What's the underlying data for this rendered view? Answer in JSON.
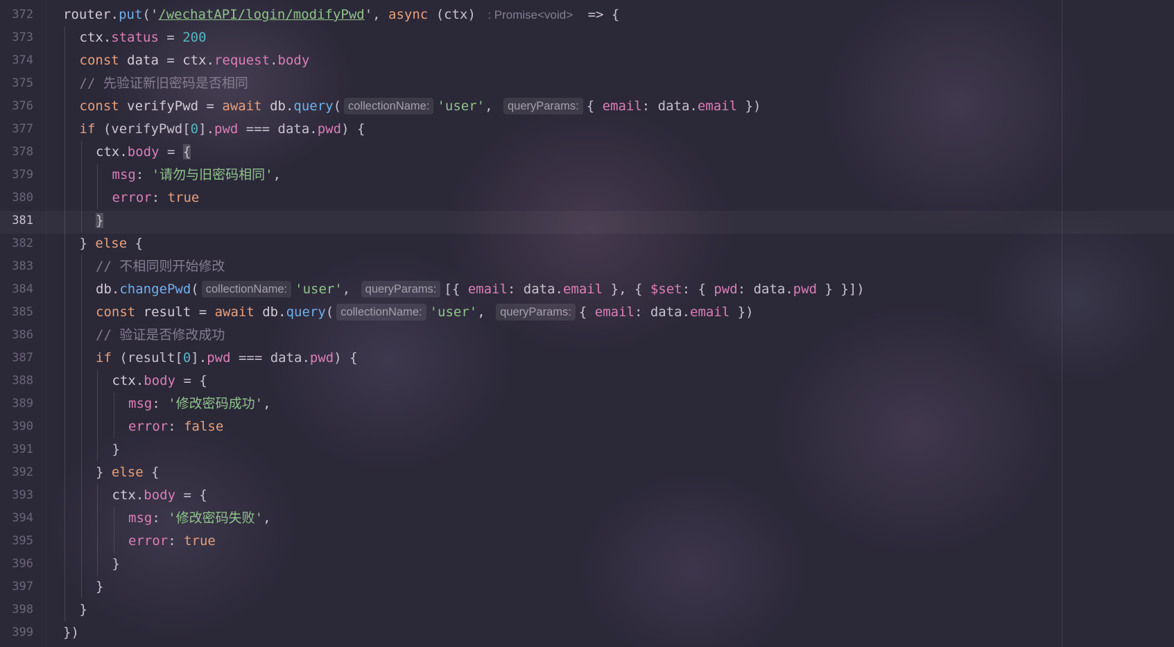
{
  "editor": {
    "current_line": "381",
    "lines": [
      {
        "n": "372",
        "indent": 0,
        "tokens": [
          {
            "t": "id",
            "v": "router."
          },
          {
            "t": "fn",
            "v": "put"
          },
          {
            "t": "pun",
            "v": "('"
          },
          {
            "t": "url",
            "v": "/wechatAPI/login/modifyPwd"
          },
          {
            "t": "pun",
            "v": "', "
          },
          {
            "t": "kw",
            "v": "async"
          },
          {
            "t": "pun",
            "v": " (ctx) "
          },
          {
            "t": "ret",
            "v": ": Promise<void>"
          },
          {
            "t": "pun",
            "v": " => {"
          }
        ]
      },
      {
        "n": "373",
        "indent": 1,
        "tokens": [
          {
            "t": "id",
            "v": "ctx."
          },
          {
            "t": "prop",
            "v": "status"
          },
          {
            "t": "pun",
            "v": " = "
          },
          {
            "t": "num",
            "v": "200"
          }
        ]
      },
      {
        "n": "374",
        "indent": 1,
        "tokens": [
          {
            "t": "kw",
            "v": "const"
          },
          {
            "t": "id",
            "v": " data = ctx."
          },
          {
            "t": "prop",
            "v": "request"
          },
          {
            "t": "pun",
            "v": "."
          },
          {
            "t": "prop",
            "v": "body"
          }
        ]
      },
      {
        "n": "375",
        "indent": 1,
        "tokens": [
          {
            "t": "cm",
            "v": "// 先验证新旧密码是否相同"
          }
        ]
      },
      {
        "n": "376",
        "indent": 1,
        "tokens": [
          {
            "t": "kw",
            "v": "const"
          },
          {
            "t": "id",
            "v": " verifyPwd = "
          },
          {
            "t": "kw",
            "v": "await"
          },
          {
            "t": "id",
            "v": " db."
          },
          {
            "t": "fn",
            "v": "query"
          },
          {
            "t": "pun",
            "v": "("
          },
          {
            "t": "hint",
            "v": "collectionName:"
          },
          {
            "t": "str",
            "v": "'user'"
          },
          {
            "t": "pun",
            "v": ", "
          },
          {
            "t": "hint",
            "v": "queryParams:"
          },
          {
            "t": "pun",
            "v": "{ "
          },
          {
            "t": "prop",
            "v": "email"
          },
          {
            "t": "pun",
            "v": ": data."
          },
          {
            "t": "prop",
            "v": "email"
          },
          {
            "t": "pun",
            "v": " })"
          }
        ]
      },
      {
        "n": "377",
        "indent": 1,
        "tokens": [
          {
            "t": "kw",
            "v": "if"
          },
          {
            "t": "pun",
            "v": " (verifyPwd["
          },
          {
            "t": "num",
            "v": "0"
          },
          {
            "t": "pun",
            "v": "]."
          },
          {
            "t": "prop",
            "v": "pwd"
          },
          {
            "t": "pun",
            "v": " === data."
          },
          {
            "t": "prop",
            "v": "pwd"
          },
          {
            "t": "pun",
            "v": ") {"
          }
        ]
      },
      {
        "n": "378",
        "indent": 2,
        "tokens": [
          {
            "t": "id",
            "v": "ctx."
          },
          {
            "t": "prop",
            "v": "body"
          },
          {
            "t": "pun",
            "v": " = "
          },
          {
            "t": "brace",
            "v": "{"
          }
        ]
      },
      {
        "n": "379",
        "indent": 3,
        "tokens": [
          {
            "t": "prop",
            "v": "msg"
          },
          {
            "t": "pun",
            "v": ": "
          },
          {
            "t": "str",
            "v": "'请勿与旧密码相同'"
          },
          {
            "t": "pun",
            "v": ","
          }
        ]
      },
      {
        "n": "380",
        "indent": 3,
        "tokens": [
          {
            "t": "prop",
            "v": "error"
          },
          {
            "t": "pun",
            "v": ": "
          },
          {
            "t": "kw",
            "v": "true"
          }
        ]
      },
      {
        "n": "381",
        "indent": 2,
        "tokens": [
          {
            "t": "brace",
            "v": "}"
          }
        ]
      },
      {
        "n": "382",
        "indent": 1,
        "tokens": [
          {
            "t": "pun",
            "v": "} "
          },
          {
            "t": "kw",
            "v": "else"
          },
          {
            "t": "pun",
            "v": " {"
          }
        ]
      },
      {
        "n": "383",
        "indent": 2,
        "tokens": [
          {
            "t": "cm",
            "v": "// 不相同则开始修改"
          }
        ]
      },
      {
        "n": "384",
        "indent": 2,
        "tokens": [
          {
            "t": "id",
            "v": "db."
          },
          {
            "t": "fn",
            "v": "changePwd"
          },
          {
            "t": "pun",
            "v": "("
          },
          {
            "t": "hint",
            "v": "collectionName:"
          },
          {
            "t": "str",
            "v": "'user'"
          },
          {
            "t": "pun",
            "v": ", "
          },
          {
            "t": "hint",
            "v": "queryParams:"
          },
          {
            "t": "pun",
            "v": "[{ "
          },
          {
            "t": "prop",
            "v": "email"
          },
          {
            "t": "pun",
            "v": ": data."
          },
          {
            "t": "prop",
            "v": "email"
          },
          {
            "t": "pun",
            "v": " }, { "
          },
          {
            "t": "prop",
            "v": "$set"
          },
          {
            "t": "pun",
            "v": ": { "
          },
          {
            "t": "prop",
            "v": "pwd"
          },
          {
            "t": "pun",
            "v": ": data."
          },
          {
            "t": "prop",
            "v": "pwd"
          },
          {
            "t": "pun",
            "v": " } }])"
          }
        ]
      },
      {
        "n": "385",
        "indent": 2,
        "tokens": [
          {
            "t": "kw",
            "v": "const"
          },
          {
            "t": "id",
            "v": " result = "
          },
          {
            "t": "kw",
            "v": "await"
          },
          {
            "t": "id",
            "v": " db."
          },
          {
            "t": "fn",
            "v": "query"
          },
          {
            "t": "pun",
            "v": "("
          },
          {
            "t": "hint",
            "v": "collectionName:"
          },
          {
            "t": "str",
            "v": "'user'"
          },
          {
            "t": "pun",
            "v": ", "
          },
          {
            "t": "hint",
            "v": "queryParams:"
          },
          {
            "t": "pun",
            "v": "{ "
          },
          {
            "t": "prop",
            "v": "email"
          },
          {
            "t": "pun",
            "v": ": data."
          },
          {
            "t": "prop",
            "v": "email"
          },
          {
            "t": "pun",
            "v": " })"
          }
        ]
      },
      {
        "n": "386",
        "indent": 2,
        "tokens": [
          {
            "t": "cm",
            "v": "// 验证是否修改成功"
          }
        ]
      },
      {
        "n": "387",
        "indent": 2,
        "tokens": [
          {
            "t": "kw",
            "v": "if"
          },
          {
            "t": "pun",
            "v": " (result["
          },
          {
            "t": "num",
            "v": "0"
          },
          {
            "t": "pun",
            "v": "]."
          },
          {
            "t": "prop",
            "v": "pwd"
          },
          {
            "t": "pun",
            "v": " === data."
          },
          {
            "t": "prop",
            "v": "pwd"
          },
          {
            "t": "pun",
            "v": ") {"
          }
        ]
      },
      {
        "n": "388",
        "indent": 3,
        "tokens": [
          {
            "t": "id",
            "v": "ctx."
          },
          {
            "t": "prop",
            "v": "body"
          },
          {
            "t": "pun",
            "v": " = {"
          }
        ]
      },
      {
        "n": "389",
        "indent": 4,
        "tokens": [
          {
            "t": "prop",
            "v": "msg"
          },
          {
            "t": "pun",
            "v": ": "
          },
          {
            "t": "str",
            "v": "'修改密码成功'"
          },
          {
            "t": "pun",
            "v": ","
          }
        ]
      },
      {
        "n": "390",
        "indent": 4,
        "tokens": [
          {
            "t": "prop",
            "v": "error"
          },
          {
            "t": "pun",
            "v": ": "
          },
          {
            "t": "kw",
            "v": "false"
          }
        ]
      },
      {
        "n": "391",
        "indent": 3,
        "tokens": [
          {
            "t": "pun",
            "v": "}"
          }
        ]
      },
      {
        "n": "392",
        "indent": 2,
        "tokens": [
          {
            "t": "pun",
            "v": "} "
          },
          {
            "t": "kw",
            "v": "else"
          },
          {
            "t": "pun",
            "v": " {"
          }
        ]
      },
      {
        "n": "393",
        "indent": 3,
        "tokens": [
          {
            "t": "id",
            "v": "ctx."
          },
          {
            "t": "prop",
            "v": "body"
          },
          {
            "t": "pun",
            "v": " = {"
          }
        ]
      },
      {
        "n": "394",
        "indent": 4,
        "tokens": [
          {
            "t": "prop",
            "v": "msg"
          },
          {
            "t": "pun",
            "v": ": "
          },
          {
            "t": "str",
            "v": "'修改密码失败'"
          },
          {
            "t": "pun",
            "v": ","
          }
        ]
      },
      {
        "n": "395",
        "indent": 4,
        "tokens": [
          {
            "t": "prop",
            "v": "error"
          },
          {
            "t": "pun",
            "v": ": "
          },
          {
            "t": "kw",
            "v": "true"
          }
        ]
      },
      {
        "n": "396",
        "indent": 3,
        "tokens": [
          {
            "t": "pun",
            "v": "}"
          }
        ]
      },
      {
        "n": "397",
        "indent": 2,
        "tokens": [
          {
            "t": "pun",
            "v": "}"
          }
        ]
      },
      {
        "n": "398",
        "indent": 1,
        "tokens": [
          {
            "t": "pun",
            "v": "}"
          }
        ]
      },
      {
        "n": "399",
        "indent": 0,
        "tokens": [
          {
            "t": "pun",
            "v": "})"
          }
        ]
      }
    ]
  }
}
